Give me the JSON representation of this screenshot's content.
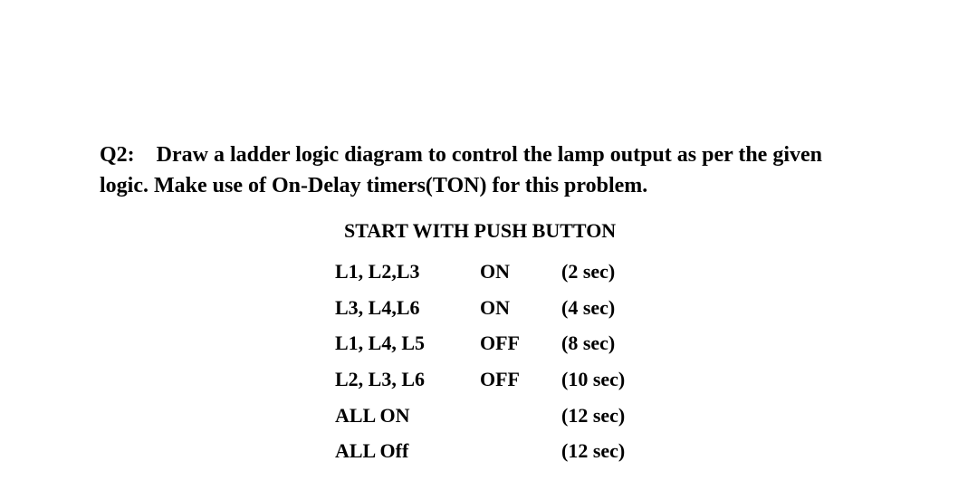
{
  "question": {
    "label": "Q2:",
    "text": "Draw a ladder logic diagram to control the lamp output as per the given logic. Make use of On-Delay timers(TON) for this problem."
  },
  "table": {
    "title": "START  WITH PUSH BUTTON",
    "rows": [
      {
        "lamps": "L1, L2,L3",
        "state": "ON",
        "time": "(2 sec)"
      },
      {
        "lamps": "L3, L4,L6",
        "state": "ON",
        "time": "(4 sec)"
      },
      {
        "lamps": "L1, L4, L5",
        "state": "OFF",
        "time": "(8 sec)"
      },
      {
        "lamps": "L2, L3, L6",
        "state": "OFF",
        "time": "(10 sec)"
      },
      {
        "lamps": "ALL  ON",
        "state": "",
        "time": "(12 sec)"
      },
      {
        "lamps": "ALL  Off",
        "state": "",
        "time": "(12 sec)"
      }
    ]
  }
}
